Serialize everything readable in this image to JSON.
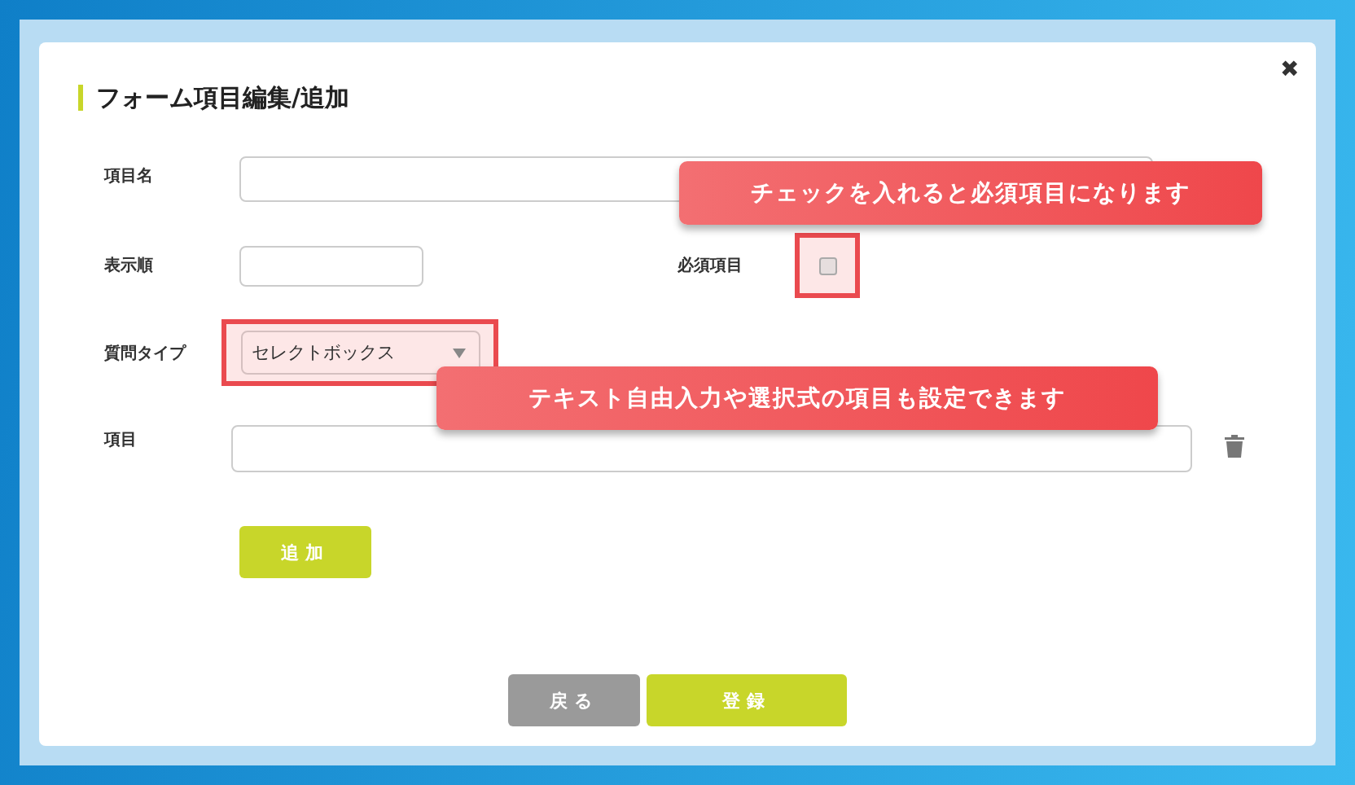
{
  "dialog": {
    "title": "フォーム項目編集/追加",
    "close": "✖"
  },
  "item_name": {
    "label": "項目名"
  },
  "display_order": {
    "label": "表示順"
  },
  "required": {
    "label": "必須項目",
    "checked": false
  },
  "question_type": {
    "label": "質問タイプ",
    "value": "セレクトボックス"
  },
  "items": {
    "label": "項目"
  },
  "add_button": "追加",
  "buttons": [
    {
      "label": "戻る",
      "kind": "secondary"
    },
    {
      "label": "登録",
      "kind": "primary"
    }
  ],
  "callouts": [
    {
      "text": "チェックを入れると必須項目になります"
    },
    {
      "text": "テキスト自由入力や選択式の項目も設定できます"
    }
  ]
}
